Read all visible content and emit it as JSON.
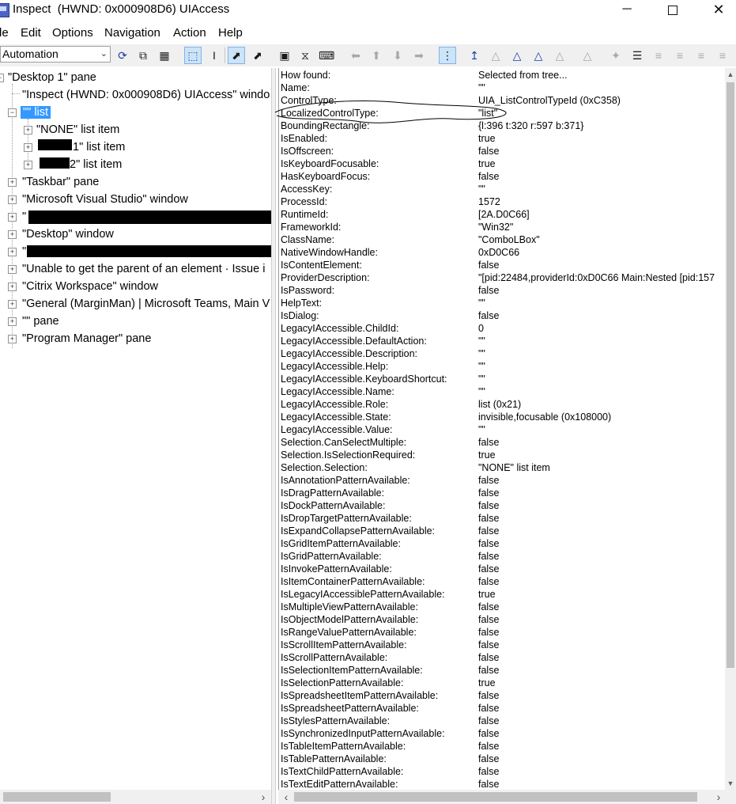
{
  "window": {
    "title": "Inspect  (HWND: 0x000908D6) UIAccess",
    "minimize": "─",
    "close": "✕"
  },
  "menu": [
    "le",
    "Edit",
    "Options",
    "Navigation",
    "Action",
    "Help"
  ],
  "toolbar": {
    "mode": "Automation",
    "icons": [
      "refresh-icon",
      "copy-icon",
      "properties-icon",
      "highlight-rect-icon",
      "caret-icon",
      "pointer-icon",
      "focus-tracking-icon",
      "rect-icon",
      "hourglass-icon",
      "keyboard-icon",
      "nav-left-icon",
      "nav-up-icon",
      "nav-down-icon",
      "nav-right-icon",
      "tree-view-icon",
      "parent-icon",
      "child-icon",
      "sibling-icon",
      "tree-icon",
      "ancestor-icon",
      "descendant-icon",
      "wand-icon",
      "options-icon",
      "arrange-icon",
      "expand-icon"
    ]
  },
  "tree": [
    {
      "label": "\"Desktop 1\" pane"
    },
    {
      "label": "\"Inspect  (HWND: 0x000908D6) UIAccess\" windo"
    },
    {
      "label": "\"\" list"
    },
    {
      "label": "\"NONE\" list item"
    },
    {
      "label": "1\" list item"
    },
    {
      "label": "2\" list item"
    },
    {
      "label": "\"Taskbar\" pane"
    },
    {
      "label": "\"Microsoft Visual Studio\" window"
    },
    {
      "label": "\""
    },
    {
      "label": "\"Desktop\" window"
    },
    {
      "label": "\""
    },
    {
      "label": "\"Unable to get the parent of an element · Issue i"
    },
    {
      "label": "\"Citrix Workspace\" window"
    },
    {
      "label": "\"General (MarginMan) | Microsoft Teams, Main V"
    },
    {
      "label": "\"\" pane"
    },
    {
      "label": "\"Program Manager\" pane"
    }
  ],
  "properties": [
    {
      "name": "How found:",
      "value": "Selected from tree..."
    },
    {
      "name": "Name:",
      "value": "\"\""
    },
    {
      "name": "ControlType:",
      "value": "UIA_ListControlTypeId (0xC358)"
    },
    {
      "name": "LocalizedControlType:",
      "value": "\"list\""
    },
    {
      "name": "BoundingRectangle:",
      "value": "{l:396 t:320 r:597 b:371}"
    },
    {
      "name": "IsEnabled:",
      "value": "true"
    },
    {
      "name": "IsOffscreen:",
      "value": "false"
    },
    {
      "name": "IsKeyboardFocusable:",
      "value": "true"
    },
    {
      "name": "HasKeyboardFocus:",
      "value": "false"
    },
    {
      "name": "AccessKey:",
      "value": "\"\""
    },
    {
      "name": "ProcessId:",
      "value": "1572"
    },
    {
      "name": "RuntimeId:",
      "value": "[2A.D0C66]"
    },
    {
      "name": "FrameworkId:",
      "value": "\"Win32\""
    },
    {
      "name": "ClassName:",
      "value": "\"ComboLBox\""
    },
    {
      "name": "NativeWindowHandle:",
      "value": "0xD0C66"
    },
    {
      "name": "IsContentElement:",
      "value": "false"
    },
    {
      "name": "ProviderDescription:",
      "value": "\"[pid:22484,providerId:0xD0C66 Main:Nested [pid:157"
    },
    {
      "name": "IsPassword:",
      "value": "false"
    },
    {
      "name": "HelpText:",
      "value": "\"\""
    },
    {
      "name": "IsDialog:",
      "value": "false"
    },
    {
      "name": "LegacyIAccessible.ChildId:",
      "value": "0"
    },
    {
      "name": "LegacyIAccessible.DefaultAction:",
      "value": "\"\""
    },
    {
      "name": "LegacyIAccessible.Description:",
      "value": "\"\""
    },
    {
      "name": "LegacyIAccessible.Help:",
      "value": "\"\""
    },
    {
      "name": "LegacyIAccessible.KeyboardShortcut:",
      "value": "\"\""
    },
    {
      "name": "LegacyIAccessible.Name:",
      "value": "\"\""
    },
    {
      "name": "LegacyIAccessible.Role:",
      "value": "list (0x21)"
    },
    {
      "name": "LegacyIAccessible.State:",
      "value": "invisible,focusable (0x108000)"
    },
    {
      "name": "LegacyIAccessible.Value:",
      "value": "\"\""
    },
    {
      "name": "Selection.CanSelectMultiple:",
      "value": "false"
    },
    {
      "name": "Selection.IsSelectionRequired:",
      "value": "true"
    },
    {
      "name": "Selection.Selection:",
      "value": "\"NONE\" list item"
    },
    {
      "name": "IsAnnotationPatternAvailable:",
      "value": "false"
    },
    {
      "name": "IsDragPatternAvailable:",
      "value": "false"
    },
    {
      "name": "IsDockPatternAvailable:",
      "value": "false"
    },
    {
      "name": "IsDropTargetPatternAvailable:",
      "value": "false"
    },
    {
      "name": "IsExpandCollapsePatternAvailable:",
      "value": "false"
    },
    {
      "name": "IsGridItemPatternAvailable:",
      "value": "false"
    },
    {
      "name": "IsGridPatternAvailable:",
      "value": "false"
    },
    {
      "name": "IsInvokePatternAvailable:",
      "value": "false"
    },
    {
      "name": "IsItemContainerPatternAvailable:",
      "value": "false"
    },
    {
      "name": "IsLegacyIAccessiblePatternAvailable:",
      "value": "true"
    },
    {
      "name": "IsMultipleViewPatternAvailable:",
      "value": "false"
    },
    {
      "name": "IsObjectModelPatternAvailable:",
      "value": "false"
    },
    {
      "name": "IsRangeValuePatternAvailable:",
      "value": "false"
    },
    {
      "name": "IsScrollItemPatternAvailable:",
      "value": "false"
    },
    {
      "name": "IsScrollPatternAvailable:",
      "value": "false"
    },
    {
      "name": "IsSelectionItemPatternAvailable:",
      "value": "false"
    },
    {
      "name": "IsSelectionPatternAvailable:",
      "value": "true"
    },
    {
      "name": "IsSpreadsheetItemPatternAvailable:",
      "value": "false"
    },
    {
      "name": "IsSpreadsheetPatternAvailable:",
      "value": "false"
    },
    {
      "name": "IsStylesPatternAvailable:",
      "value": "false"
    },
    {
      "name": "IsSynchronizedInputPatternAvailable:",
      "value": "false"
    },
    {
      "name": "IsTableItemPatternAvailable:",
      "value": "false"
    },
    {
      "name": "IsTablePatternAvailable:",
      "value": "false"
    },
    {
      "name": "IsTextChildPatternAvailable:",
      "value": "false"
    },
    {
      "name": "IsTextEditPatternAvailable:",
      "value": "false"
    }
  ]
}
